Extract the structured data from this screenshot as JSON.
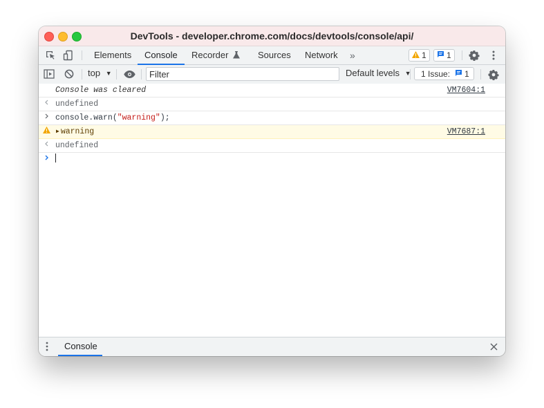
{
  "window": {
    "title": "DevTools - developer.chrome.com/docs/devtools/console/api/"
  },
  "tabs": [
    {
      "label": "Elements",
      "active": false
    },
    {
      "label": "Console",
      "active": true
    },
    {
      "label": "Recorder",
      "active": false
    },
    {
      "label": "Sources",
      "active": false
    },
    {
      "label": "Network",
      "active": false
    }
  ],
  "badges": {
    "warnings": "1",
    "messages": "1"
  },
  "toolbar": {
    "context": "top",
    "filter_placeholder": "Filter",
    "levels": "Default levels",
    "issues_label": "1 Issue:",
    "issues_count": "1"
  },
  "console": {
    "rows": [
      {
        "type": "info",
        "text": "Console was cleared",
        "source": "VM7604:1"
      },
      {
        "type": "result",
        "text": "undefined"
      },
      {
        "type": "input",
        "text_prefix": "console.warn(",
        "string": "\"warning\"",
        "text_suffix": ");"
      },
      {
        "type": "warning",
        "text": "warning",
        "source": "VM7687:1"
      },
      {
        "type": "result",
        "text": "undefined"
      }
    ]
  },
  "drawer": {
    "tab_label": "Console"
  },
  "colors": {
    "accent": "#1a73e8",
    "warning_bg": "#fffbe5",
    "warning_icon": "#f2a600",
    "string": "#c41a16"
  },
  "icons": [
    "inspect-icon",
    "device-toggle-icon",
    "flask-icon",
    "more-tabs-icon",
    "warning-icon",
    "message-icon",
    "gear-icon",
    "kebab-icon",
    "sidebar-toggle-icon",
    "clear-icon",
    "dropdown-arrow-icon",
    "eye-icon",
    "result-arrow-icon",
    "prompt-icon",
    "expand-triangle-icon",
    "close-icon"
  ]
}
